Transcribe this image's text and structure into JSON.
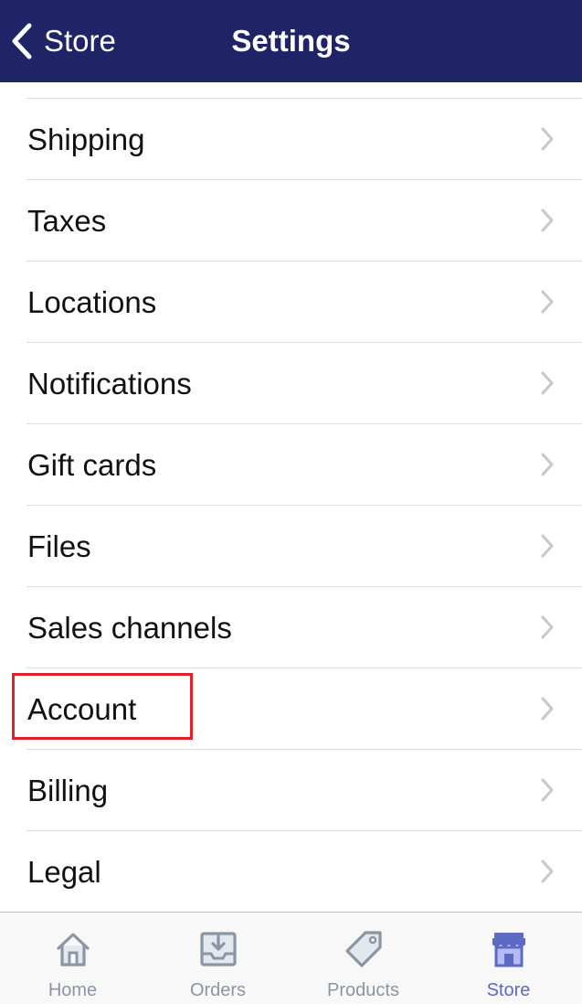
{
  "nav": {
    "back_label": "Store",
    "title": "Settings"
  },
  "settings_items": [
    {
      "label": "Shipping"
    },
    {
      "label": "Taxes"
    },
    {
      "label": "Locations"
    },
    {
      "label": "Notifications"
    },
    {
      "label": "Gift cards"
    },
    {
      "label": "Files"
    },
    {
      "label": "Sales channels"
    },
    {
      "label": "Account",
      "highlighted": true
    },
    {
      "label": "Billing"
    },
    {
      "label": "Legal"
    }
  ],
  "tabs": [
    {
      "label": "Home",
      "icon": "home-icon",
      "active": false
    },
    {
      "label": "Orders",
      "icon": "orders-icon",
      "active": false
    },
    {
      "label": "Products",
      "icon": "tag-icon",
      "active": false
    },
    {
      "label": "Store",
      "icon": "store-icon",
      "active": true
    }
  ],
  "colors": {
    "nav_background": "#1f2466",
    "active_tab": "#5c6ac4",
    "inactive_tab": "#8b95a3",
    "highlight": "#e0202a"
  }
}
